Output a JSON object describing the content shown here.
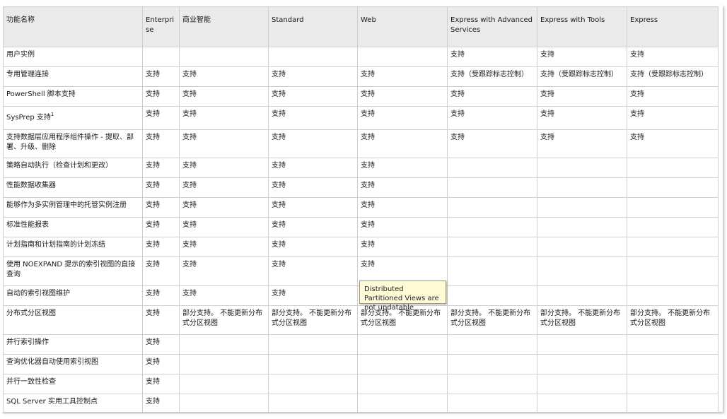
{
  "headers": [
    "功能名称",
    "Enterprise",
    "商业智能",
    "Standard",
    "Web",
    "Express with Advanced Services",
    "Express with Tools",
    "Express"
  ],
  "rows": [
    {
      "feature": "用户实例",
      "cells": [
        "",
        "",
        "",
        "",
        "支持",
        "支持",
        "支持"
      ]
    },
    {
      "feature": "专用管理连接",
      "cells": [
        "支持",
        "支持",
        "支持",
        "支持",
        "支持（受跟踪标志控制）",
        "支持（受跟踪标志控制）",
        "支持（受跟踪标志控制）"
      ]
    },
    {
      "feature": "PowerShell 脚本支持",
      "cells": [
        "支持",
        "支持",
        "支持",
        "支持",
        "支持",
        "支持",
        "支持"
      ]
    },
    {
      "feature": "SysPrep 支持",
      "sup": "1",
      "cells": [
        "支持",
        "支持",
        "支持",
        "支持",
        "支持",
        "支持",
        "支持"
      ]
    },
    {
      "feature": "支持数据层应用程序组件操作 - 提取、部署、升级、删除",
      "cells": [
        "支持",
        "支持",
        "支持",
        "支持",
        "支持",
        "支持",
        "支持"
      ]
    },
    {
      "feature": "策略自动执行（检查计划和更改）",
      "cells": [
        "支持",
        "支持",
        "支持",
        "支持",
        "",
        "",
        ""
      ]
    },
    {
      "feature": "性能数据收集器",
      "cells": [
        "支持",
        "支持",
        "支持",
        "支持",
        "",
        "",
        ""
      ]
    },
    {
      "feature": "能够作为多实例管理中的托管实例注册",
      "cells": [
        "支持",
        "支持",
        "支持",
        "支持",
        "",
        "",
        ""
      ]
    },
    {
      "feature": "标准性能报表",
      "cells": [
        "支持",
        "支持",
        "支持",
        "支持",
        "",
        "",
        ""
      ]
    },
    {
      "feature": "计划指南和计划指南的计划冻结",
      "cells": [
        "支持",
        "支持",
        "支持",
        "支持",
        "",
        "",
        ""
      ]
    },
    {
      "feature": "使用 NOEXPAND 提示的索引视图的直接查询",
      "cells": [
        "支持",
        "支持",
        "支持",
        "支持",
        "",
        "",
        ""
      ]
    },
    {
      "feature": "自动的索引视图维护",
      "cells": [
        "支持",
        "支持",
        "支持",
        "",
        "",
        "",
        ""
      ]
    },
    {
      "feature": "分布式分区视图",
      "cells": [
        "支持",
        "部分支持。 不能更新分布式分区视图",
        "部分支持。 不能更新分布式分区视图",
        "部分支持。 不能更新分布式分区视图",
        "部分支持。 不能更新分布式分区视图",
        "部分支持。 不能更新分布式分区视图",
        "部分支持。 不能更新分布式分区视图"
      ]
    },
    {
      "feature": "并行索引操作",
      "cells": [
        "支持",
        "",
        "",
        "",
        "",
        "",
        ""
      ]
    },
    {
      "feature": "查询优化器自动使用索引视图",
      "cells": [
        "支持",
        "",
        "",
        "",
        "",
        "",
        ""
      ]
    },
    {
      "feature": "并行一致性检查",
      "cells": [
        "支持",
        "",
        "",
        "",
        "",
        "",
        ""
      ]
    },
    {
      "feature": "SQL Server 实用工具控制点",
      "cells": [
        "支持",
        "",
        "",
        "",
        "",
        "",
        ""
      ]
    }
  ],
  "tooltip": "Distributed Partitioned Views are not updatable"
}
